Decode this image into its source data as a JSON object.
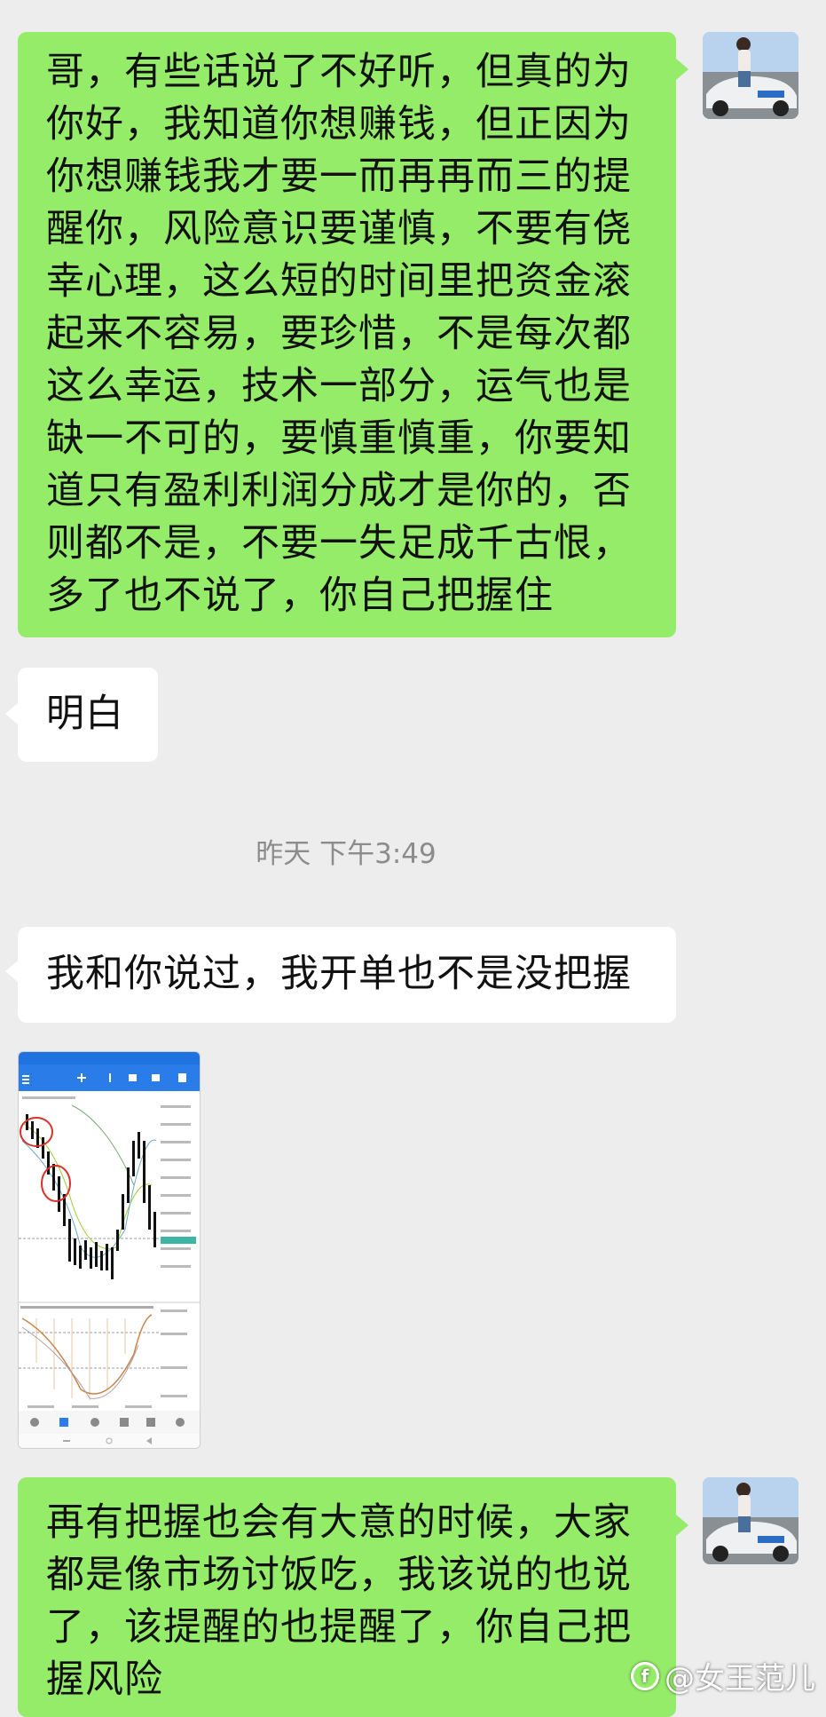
{
  "messages": {
    "m1": {
      "direction": "outgoing",
      "lines": [
        "哥，有些话说了不好听，但真的为",
        "你好，我知道你想赚钱，但正因为",
        "你想赚钱我才要一而再再而三的提",
        "醒你，风险意识要谨慎，不要有侥",
        "幸心理，这么短的时间里把资金滚",
        "起来不容易，要珍惜，不是每次都",
        "这么幸运，技术一部分，运气也是",
        "缺一不可的，要慎重慎重，你要知",
        "道只有盈利利润分成才是你的，否",
        "则都不是，不要一失足成千古恨，",
        "多了也不说了，你自己把握住"
      ]
    },
    "m2": {
      "direction": "incoming",
      "text": "明白"
    },
    "timestamp": "昨天 下午3:49",
    "m3": {
      "direction": "incoming",
      "text": "我和你说过，我开单也不是没把握"
    },
    "m4": {
      "direction": "incoming",
      "type": "image",
      "description_icon": "trading-chart-screenshot"
    },
    "m5": {
      "direction": "outgoing",
      "lines": [
        "再有把握也会有大意的时候，大家",
        "都是像市场讨饭吃，我该说的也说",
        "了，该提醒的也提醒了，你自己把",
        "握风险"
      ]
    }
  },
  "watermark": {
    "text": "@女王范儿",
    "logo": "f"
  },
  "colors": {
    "background": "#ededed",
    "outgoing_bubble": "#95ec69",
    "incoming_bubble": "#ffffff",
    "timestamp": "#8c8c8c"
  }
}
